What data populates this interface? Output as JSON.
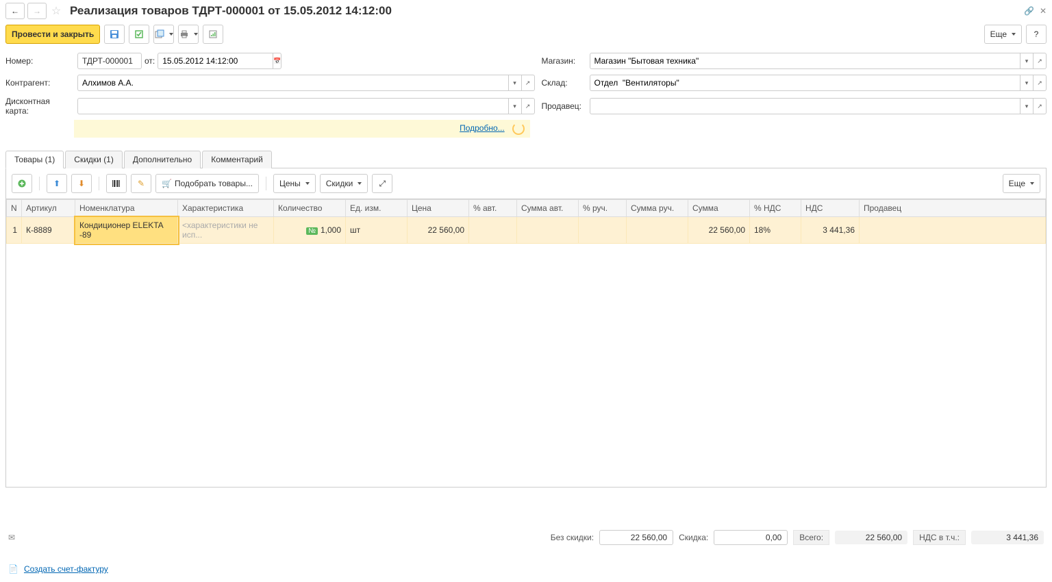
{
  "title": "Реализация товаров ТДРТ-000001 от 15.05.2012 14:12:00",
  "toolbar": {
    "post_close": "Провести и закрыть",
    "more": "Еще",
    "help": "?"
  },
  "form": {
    "number_label": "Номер:",
    "number": "ТДРТ-000001",
    "from_label": "от:",
    "date": "15.05.2012 14:12:00",
    "store_label": "Магазин:",
    "store": "Магазин \"Бытовая техника\"",
    "counterparty_label": "Контрагент:",
    "counterparty": "Алхимов А.А.",
    "warehouse_label": "Склад:",
    "warehouse": "Отдел  \"Вентиляторы\"",
    "discount_card_label": "Дисконтная карта:",
    "discount_card": "",
    "seller_label": "Продавец:",
    "seller": "",
    "details_link": "Подробно..."
  },
  "tabs": [
    "Товары (1)",
    "Скидки (1)",
    "Дополнительно",
    "Комментарий"
  ],
  "tabbar": {
    "pick": "Подобрать товары...",
    "prices": "Цены",
    "discounts": "Скидки",
    "more": "Еще"
  },
  "grid": {
    "headers": [
      "N",
      "Артикул",
      "Номенклатура",
      "Характеристика",
      "Количество",
      "Ед. изм.",
      "Цена",
      "% авт.",
      "Сумма авт.",
      "% руч.",
      "Сумма руч.",
      "Сумма",
      "% НДС",
      "НДС",
      "Продавец"
    ],
    "row": {
      "n": "1",
      "art": "К-8889",
      "nom": "Кондиционер ELEKTA -89",
      "char_ph": "<характеристики не исп...",
      "qty": "1,000",
      "unit": "шт",
      "price": "22 560,00",
      "pauto": "",
      "sauto": "",
      "pman": "",
      "sman": "",
      "sum": "22 560,00",
      "vatpct": "18%",
      "vat": "3 441,36",
      "seller": ""
    }
  },
  "footer": {
    "no_discount_label": "Без скидки:",
    "no_discount": "22 560,00",
    "discount_label": "Скидка:",
    "discount": "0,00",
    "total_label": "Всего:",
    "total": "22 560,00",
    "vat_label": "НДС в т.ч.:",
    "vat": "3 441,36"
  },
  "bottom_link": "Создать счет-фактуру"
}
